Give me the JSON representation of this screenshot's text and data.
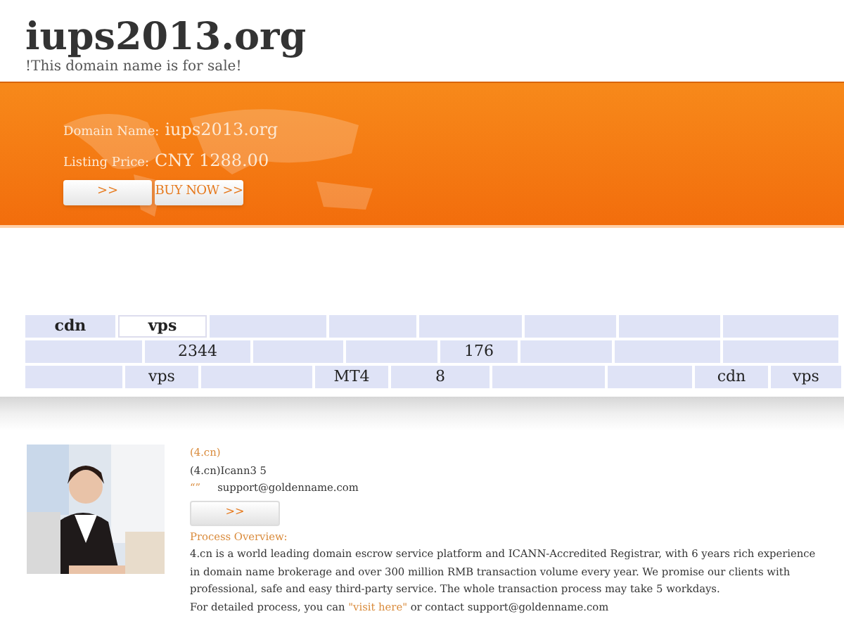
{
  "header": {
    "title": "iups2013.org",
    "subtitle": "!This domain name is for sale!"
  },
  "banner": {
    "domain_label": "Domain Name:",
    "domain": "iups2013.org",
    "price_label": "Listing Price:",
    "price": "CNY 1288.00",
    "buttons": [
      ">>",
      "BUY NOW >>"
    ]
  },
  "table": {
    "rows": [
      [
        {
          "text": "cdn",
          "selected": false
        },
        {
          "text": "vps",
          "selected": true
        },
        {
          "selected": false
        },
        {
          "selected": false
        },
        {
          "selected": false
        },
        {
          "selected": false
        },
        {
          "selected": false
        },
        {
          "selected": false
        }
      ],
      [
        {},
        {
          "text": "2344"
        },
        {},
        {},
        {
          "text": "176"
        },
        {},
        {},
        {}
      ],
      [
        {},
        {
          "text": "vps"
        },
        {},
        {
          "text": "MT4"
        },
        {
          "text": "8"
        },
        {},
        {},
        {
          "text": "cdn"
        },
        {
          "text": "vps"
        }
      ]
    ]
  },
  "info": {
    "heading": "(4.cn)",
    "line": "(4.cn)Icann3 5",
    "contact_mark": "“”",
    "email": "support@goldenname.com",
    "button": ">>",
    "overview_title": "Process Overview:",
    "overview": "4.cn is a world leading domain escrow service platform and ICANN-Accredited Registrar, with 6 years rich experience in domain name brokerage and over 300 million RMB transaction volume every year. We promise our clients with professional, safe and easy third-party service. The whole transaction process may take 5 workdays.",
    "detail_before": "For detailed process, you can ",
    "detail_link": "\"visit here\"",
    "detail_after": " or contact support@goldenname.com"
  }
}
